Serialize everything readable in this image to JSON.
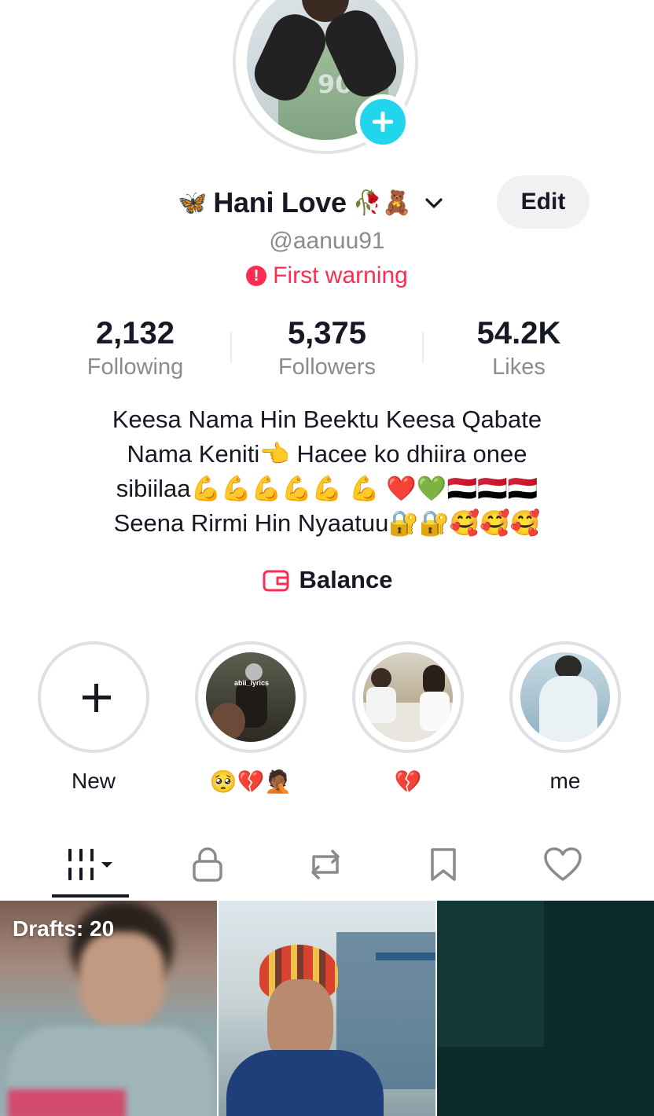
{
  "profile": {
    "display_name": "Hani Love",
    "name_prefix_emoji": "🦋",
    "name_suffix_emoji": "🥀🧸",
    "username": "@aanuu91",
    "warning": "First warning",
    "edit_label": "Edit"
  },
  "stats": [
    {
      "value": "2,132",
      "label": "Following"
    },
    {
      "value": "5,375",
      "label": "Followers"
    },
    {
      "value": "54.2K",
      "label": "Likes"
    }
  ],
  "bio": "Keesa Nama Hin Beektu Keesa Qabate\nNama Keniti👈 Hacee ko dhiira onee\nsibiilaa💪💪💪💪💪 💪 ❤️💚🇾🇪🇾🇪🇾🇪\nSeena Rirmi Hin Nyaatuu🔐🔐🥰🥰🥰",
  "balance_label": "Balance",
  "highlights": [
    {
      "label": "New"
    },
    {
      "label": "🥺💔🤦🏾",
      "overlay_text": "abii_lyrics"
    },
    {
      "label": "💔"
    },
    {
      "label": "me"
    }
  ],
  "tabs": [
    "videos-grid",
    "private",
    "reposts",
    "favorites",
    "liked"
  ],
  "grid": {
    "drafts_label": "Drafts: 20"
  },
  "colors": {
    "accent": "#fe2c55",
    "add_badge": "#20d5ec",
    "text_primary": "#161823",
    "text_secondary": "#8a8b91"
  }
}
